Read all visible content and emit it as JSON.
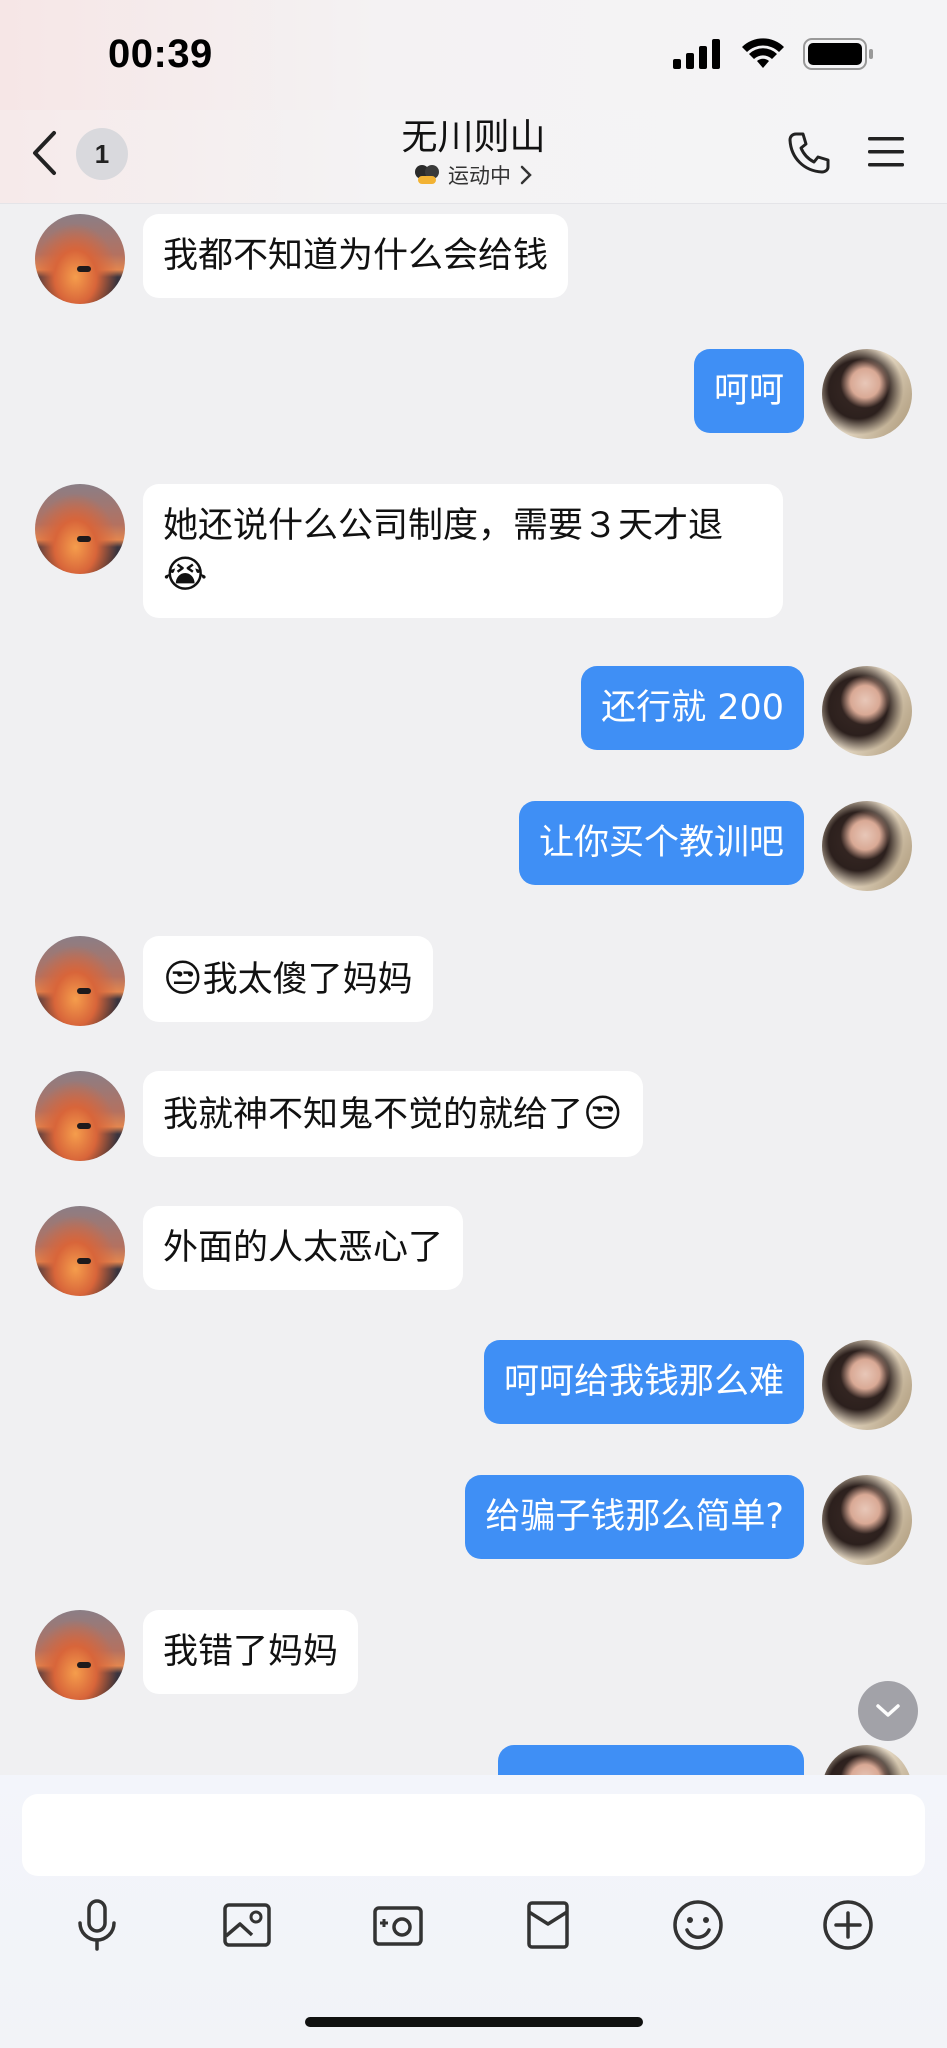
{
  "status_bar": {
    "time": "00:39"
  },
  "nav": {
    "unread_count": "1",
    "title": "无川则山",
    "status": "运动中"
  },
  "messages": [
    {
      "side": "in",
      "text": "我都不知道为什么会给钱"
    },
    {
      "side": "out",
      "text": "呵呵"
    },
    {
      "side": "in",
      "text": "她还说什么公司制度，需要３天才退",
      "emoji": "😭"
    },
    {
      "side": "out",
      "text": "还行就 200"
    },
    {
      "side": "out",
      "text": "让你买个教训吧"
    },
    {
      "side": "in",
      "text": "我太傻了妈妈",
      "emoji_before": "😒"
    },
    {
      "side": "in",
      "text": "我就神不知鬼不觉的就给了",
      "emoji": "😒"
    },
    {
      "side": "in",
      "text": "外面的人太恶心了"
    },
    {
      "side": "out",
      "text": "呵呵给我钱那么难"
    },
    {
      "side": "out",
      "text": "给骗子钱那么简单?"
    },
    {
      "side": "in",
      "text": "我错了妈妈"
    }
  ],
  "input": {
    "placeholder": ""
  },
  "toolbar": [
    "microphone-icon",
    "image-icon",
    "camera-icon",
    "red-packet-icon",
    "emoji-icon",
    "plus-icon"
  ],
  "colors": {
    "outgoing_bubble": "#3f8ff5",
    "incoming_bubble": "#ffffff",
    "background": "#f0f0f2"
  }
}
